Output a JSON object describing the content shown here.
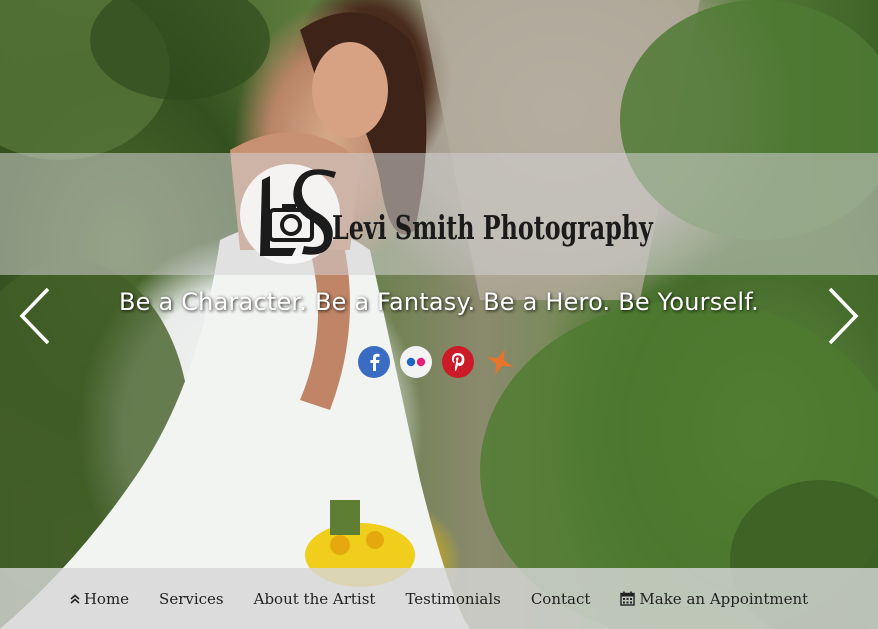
{
  "brand": {
    "name": "Levi Smith Photography",
    "monogram": "LS"
  },
  "hero": {
    "tagline": "Be a Character. Be a Fantasy. Be a Hero. Be Yourself."
  },
  "carousel": {
    "prev_icon": "chevron-left-icon",
    "next_icon": "chevron-right-icon"
  },
  "social": [
    {
      "name": "facebook",
      "icon": "facebook-icon",
      "color": "#3b6cc4"
    },
    {
      "name": "flickr",
      "icon": "flickr-icon",
      "color": "#f3f3f3"
    },
    {
      "name": "pinterest",
      "icon": "pinterest-icon",
      "color": "#cc1b28"
    },
    {
      "name": "star",
      "icon": "star-icon",
      "color": "#e8742b"
    }
  ],
  "nav": {
    "items": [
      {
        "label": "Home",
        "icon": "double-chevron-up-icon"
      },
      {
        "label": "Services"
      },
      {
        "label": "About the Artist"
      },
      {
        "label": "Testimonials"
      },
      {
        "label": "Contact"
      },
      {
        "label": "Make an Appointment",
        "icon": "calendar-icon"
      }
    ]
  }
}
